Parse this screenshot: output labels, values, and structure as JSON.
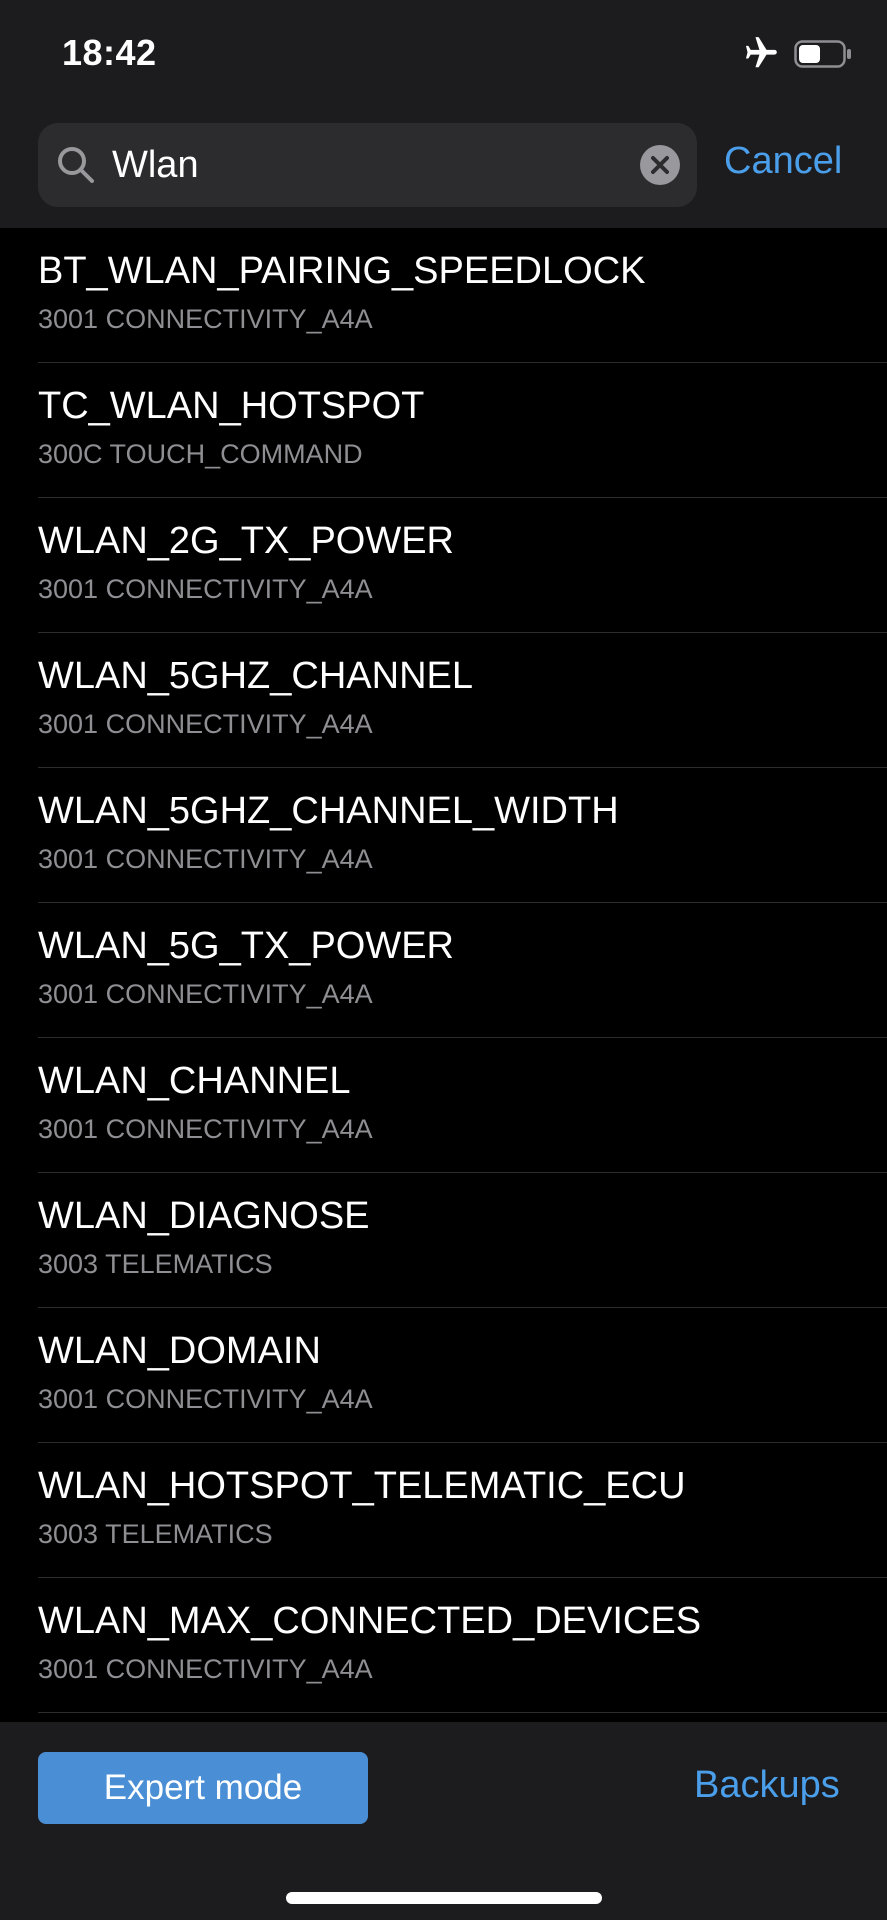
{
  "status_bar": {
    "time": "18:42",
    "airplane_icon": "airplane-icon",
    "battery_icon": "battery-icon",
    "battery_level": 0.5
  },
  "search": {
    "value": "Wlan",
    "icon": "search-icon",
    "clear_icon": "clear-icon",
    "cancel_label": "Cancel"
  },
  "results": [
    {
      "title": "BT_WLAN_PAIRING_SPEEDLOCK",
      "subtitle": "3001 CONNECTIVITY_A4A"
    },
    {
      "title": "TC_WLAN_HOTSPOT",
      "subtitle": "300C TOUCH_COMMAND"
    },
    {
      "title": "WLAN_2G_TX_POWER",
      "subtitle": "3001 CONNECTIVITY_A4A"
    },
    {
      "title": "WLAN_5GHZ_CHANNEL",
      "subtitle": "3001 CONNECTIVITY_A4A"
    },
    {
      "title": "WLAN_5GHZ_CHANNEL_WIDTH",
      "subtitle": "3001 CONNECTIVITY_A4A"
    },
    {
      "title": "WLAN_5G_TX_POWER",
      "subtitle": "3001 CONNECTIVITY_A4A"
    },
    {
      "title": "WLAN_CHANNEL",
      "subtitle": "3001 CONNECTIVITY_A4A"
    },
    {
      "title": "WLAN_DIAGNOSE",
      "subtitle": "3003 TELEMATICS"
    },
    {
      "title": "WLAN_DOMAIN",
      "subtitle": "3001 CONNECTIVITY_A4A"
    },
    {
      "title": "WLAN_HOTSPOT_TELEMATIC_ECU",
      "subtitle": "3003 TELEMATICS"
    },
    {
      "title": "WLAN_MAX_CONNECTED_DEVICES",
      "subtitle": "3001 CONNECTIVITY_A4A"
    }
  ],
  "bottom_bar": {
    "expert_mode_label": "Expert mode",
    "backups_label": "Backups"
  },
  "colors": {
    "accent": "#4a9eea",
    "button": "#4a8fd6",
    "background": "#000000",
    "bar_background": "#1c1c1e"
  }
}
